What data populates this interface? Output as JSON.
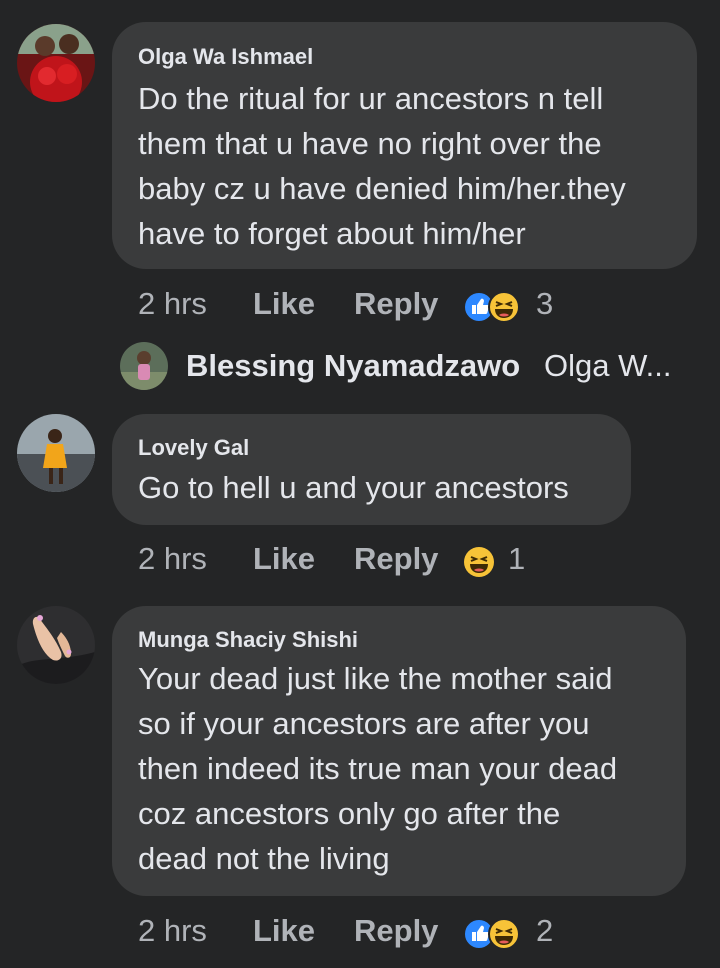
{
  "comments": [
    {
      "author": "Olga Wa Ishmael",
      "text_lines": [
        "Do the ritual for ur ancestors n tell",
        "them that u have no right over the",
        "baby cz u have denied him/her.they",
        "have to forget about him/her"
      ],
      "time": "2 hrs",
      "like_label": "Like",
      "reply_label": "Reply",
      "reaction_icons": [
        "like-reaction-icon",
        "haha-reaction-icon"
      ],
      "reaction_count": "3"
    },
    {
      "author": "Lovely Gal",
      "text_lines": [
        "Go to hell u and your ancestors"
      ],
      "time": "2 hrs",
      "like_label": "Like",
      "reply_label": "Reply",
      "reaction_icons": [
        "haha-reaction-icon"
      ],
      "reaction_count": "1"
    },
    {
      "author": "Munga Shaciy Shishi",
      "text_lines": [
        "Your dead just like the mother said",
        "so if your ancestors are after you",
        "then indeed its true man your dead",
        "coz ancestors only go after the",
        "dead not the living"
      ],
      "time": "2 hrs",
      "like_label": "Like",
      "reply_label": "Reply",
      "reaction_icons": [
        "like-reaction-icon",
        "haha-reaction-icon"
      ],
      "reaction_count": "2"
    }
  ],
  "reply_preview": {
    "author": "Blessing Nyamadzawo",
    "snippet": "Olga W..."
  },
  "colors": {
    "background": "#242526",
    "bubble": "#3a3b3c",
    "text": "#e4e6eb",
    "secondary_text": "#b0b3b8",
    "like_blue": "#2d88ff",
    "haha_yellow": "#f7c338"
  }
}
